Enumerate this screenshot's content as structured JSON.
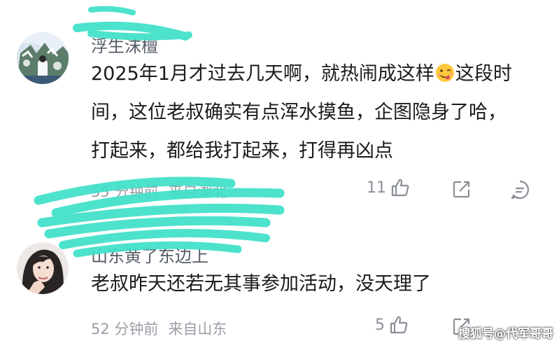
{
  "comments": [
    {
      "username": "浮生沫檀",
      "text_line1_a": "2025年1月才过去几天啊，就热闹成这样",
      "text_line1_b": "这段时",
      "text_line2": "间，这位老叔确实有点浑水摸鱼，企图隐身了哈，",
      "text_line3": "打起来，都给我打起来，打得再凶点",
      "emoji_icon": "savoring-face-emoji",
      "time": "55 分钟前",
      "location": "来自湖北",
      "likes": "11"
    },
    {
      "username": "山东黄了东边上",
      "text": "老叔昨天还若无其事参加活动，没天理了",
      "time": "52 分钟前",
      "location": "来自山东",
      "likes": "5"
    }
  ],
  "watermark": "搜狐号@代军哥哥",
  "colors": {
    "scribble": "#3ee0c8",
    "meta_text": "#9a9ea6",
    "icon": "#8a8f98"
  },
  "icons": [
    "thumbs-up-icon",
    "share-icon",
    "reply-icon"
  ]
}
